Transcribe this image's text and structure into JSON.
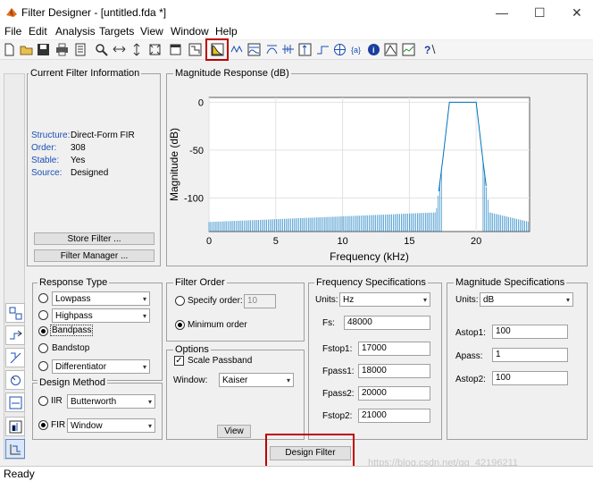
{
  "window": {
    "title": "Filter Designer - [untitled.fda *]"
  },
  "menubar": [
    "File",
    "Edit",
    "Analysis",
    "Targets",
    "View",
    "Window",
    "Help"
  ],
  "toolbar_icons": [
    "new-icon",
    "open-icon",
    "save-icon",
    "print-icon",
    "print-preview-icon",
    "zoom-in-icon",
    "zoom-x-icon",
    "zoom-y-icon",
    "full-view-icon",
    "new-window-icon",
    "filter-spec-icon",
    "magnitude-response-icon",
    "phase-response-icon",
    "mag-phase-icon",
    "group-delay-icon",
    "phase-delay-icon",
    "impulse-response-icon",
    "step-response-icon",
    "pole-zero-icon",
    "coefficients-icon",
    "info-icon",
    "cost-icon",
    "round-off-noise-icon",
    "help-icon"
  ],
  "current_filter": {
    "heading": "Current Filter Information",
    "rows": [
      {
        "label": "Structure:",
        "value": "Direct-Form FIR"
      },
      {
        "label": "Order:",
        "value": "308"
      },
      {
        "label": "Stable:",
        "value": "Yes"
      },
      {
        "label": "Source:",
        "value": "Designed"
      }
    ],
    "store_btn": "Store Filter ...",
    "manager_btn": "Filter Manager ..."
  },
  "chart_data": {
    "type": "line",
    "title": "Magnitude Response (dB)",
    "xlabel": "Frequency (kHz)",
    "ylabel": "Magnitude (dB)",
    "xlim": [
      0,
      24
    ],
    "ylim": [
      -135,
      5
    ],
    "xticks": [
      "0",
      "5",
      "10",
      "15",
      "20"
    ],
    "yticks": [
      "0",
      "-50",
      "-100"
    ],
    "grid": true,
    "series": [
      {
        "x": [
          0,
          17,
          17.5,
          18,
          20,
          20.5,
          21,
          24
        ],
        "values": [
          -125,
          -115,
          -60,
          0,
          0,
          -60,
          -115,
          -125
        ]
      }
    ],
    "color": "#0072bd"
  },
  "response_type": {
    "heading": "Response Type",
    "options": [
      {
        "label": "Lowpass",
        "selected": false,
        "dropdown": true
      },
      {
        "label": "Highpass",
        "selected": false,
        "dropdown": true
      },
      {
        "label": "Bandpass",
        "selected": true,
        "dropdown": false
      },
      {
        "label": "Bandstop",
        "selected": false,
        "dropdown": false
      },
      {
        "label": "Differentiator",
        "selected": false,
        "dropdown": true
      }
    ]
  },
  "design_method": {
    "heading": "Design Method",
    "iir_label": "IIR",
    "iir_value": "Butterworth",
    "fir_label": "FIR",
    "fir_value": "Window"
  },
  "filter_order": {
    "heading": "Filter Order",
    "specify_label": "Specify order:",
    "specify_value": "10",
    "minimum_label": "Minimum order"
  },
  "options": {
    "heading": "Options",
    "scale_label": "Scale Passband",
    "window_label": "Window:",
    "window_value": "Kaiser",
    "view_btn": "View"
  },
  "freq_spec": {
    "heading": "Frequency Specifications",
    "units_label": "Units:",
    "units_value": "Hz",
    "fields": [
      {
        "label": "Fs:",
        "value": "48000"
      },
      {
        "label": "Fstop1:",
        "value": "17000"
      },
      {
        "label": "Fpass1:",
        "value": "18000"
      },
      {
        "label": "Fpass2:",
        "value": "20000"
      },
      {
        "label": "Fstop2:",
        "value": "21000"
      }
    ]
  },
  "mag_spec": {
    "heading": "Magnitude Specifications",
    "units_label": "Units:",
    "units_value": "dB",
    "fields": [
      {
        "label": "Astop1:",
        "value": "100"
      },
      {
        "label": "Apass:",
        "value": "1"
      },
      {
        "label": "Astop2:",
        "value": "100"
      }
    ]
  },
  "design_btn": "Design Filter",
  "status": "Ready",
  "watermark": "https://blog.csdn.net/qq_42196211"
}
